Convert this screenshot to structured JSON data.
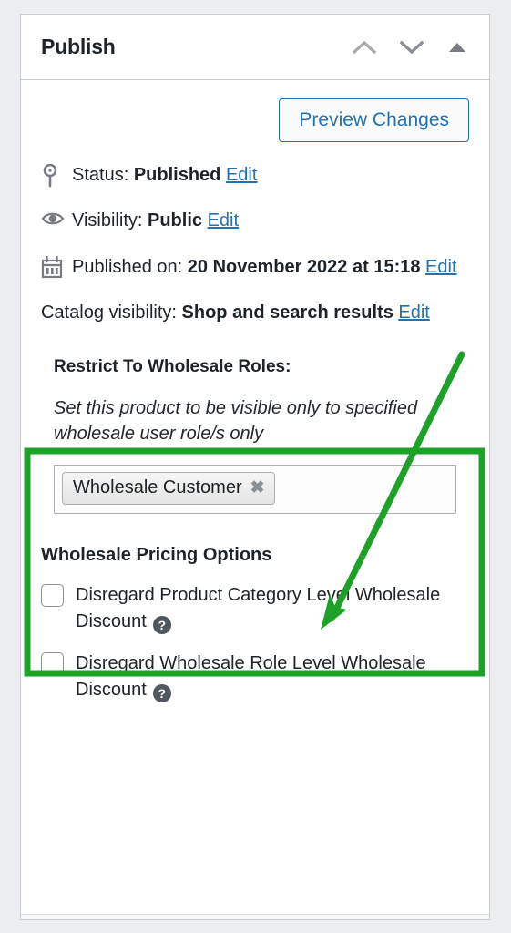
{
  "panel": {
    "title": "Publish",
    "header_icons": [
      {
        "name": "chevron-up-icon",
        "glyph": "chevron-up"
      },
      {
        "name": "chevron-down-icon",
        "glyph": "chevron-down"
      },
      {
        "name": "toggle-panel-icon",
        "glyph": "triangle-up"
      }
    ],
    "preview_button": "Preview Changes",
    "status": {
      "icon": "pin-icon",
      "label": "Status:",
      "value": "Published",
      "edit_link": "Edit"
    },
    "visibility": {
      "icon": "eye-icon",
      "label": "Visibility:",
      "value": "Public",
      "edit_link": "Edit"
    },
    "published_on": {
      "icon": "calendar-icon",
      "label": "Published on:",
      "value": "20 November 2022 at 15:18",
      "edit_link": "Edit"
    },
    "catalog_visibility": {
      "label": "Catalog visibility:",
      "value": "Shop and search results",
      "edit_link": "Edit"
    },
    "restrict": {
      "title": "Restrict To Wholesale Roles:",
      "description": "Set this product to be visible only to specified wholesale user role/s only",
      "selected_roles": [
        {
          "label": "Wholesale Customer",
          "remove_glyph": "✖"
        }
      ]
    },
    "pricing": {
      "title": "Wholesale Pricing Options",
      "options": [
        {
          "label": "Disregard Product Category Level Wholesale Discount",
          "checked": false,
          "help": "?"
        },
        {
          "label": "Disregard Wholesale Role Level Wholesale Discount",
          "checked": false,
          "help": "?"
        }
      ]
    }
  },
  "annotation": {
    "highlight_color": "#1ea128",
    "arrow_color": "#1ea128",
    "highlight_target": "restrict-to-wholesale-roles-section",
    "arrow_points_to": "wholesale-role-select-field"
  },
  "colors": {
    "accent_blue": "#2271b1",
    "text_dark": "#1d2327",
    "icon_gray": "#787c82",
    "panel_bg": "#ffffff",
    "page_bg": "#eceef0"
  }
}
